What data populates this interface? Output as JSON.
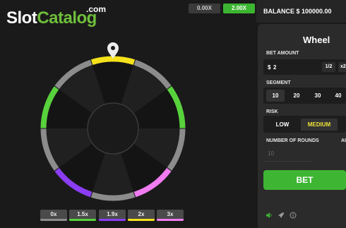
{
  "logo": {
    "word1": "Slot",
    "word2": "Catalog",
    "suffix": ".com"
  },
  "history": [
    "0.00X",
    "2.00X"
  ],
  "balance": "BALANCE $ 100000.00",
  "panel": {
    "title": "Wheel",
    "bet_amount_label": "BET AMOUNT",
    "currency": "$",
    "bet_amount": "2",
    "half_label": "1/2",
    "double_label": "x2",
    "segment_label": "SEGMENT",
    "segments": [
      "10",
      "20",
      "30",
      "40"
    ],
    "selected_segment": "10",
    "risk_label": "RISK",
    "risk_options": [
      "LOW",
      "MEDIUM"
    ],
    "selected_risk": "MEDIUM",
    "rounds_label": "NUMBER OF ROUNDS",
    "rounds_value": "10",
    "auto_label": "AU",
    "bet_button": "BET"
  },
  "wheel": {
    "segment_count": 10,
    "segments": [
      {
        "multiplier": "2x",
        "color": "#f5e21b"
      },
      {
        "multiplier": "0x",
        "color": "#8c8c8c"
      },
      {
        "multiplier": "1.5x",
        "color": "#58d23c"
      },
      {
        "multiplier": "0x",
        "color": "#8c8c8c"
      },
      {
        "multiplier": "3x",
        "color": "#f07cf0"
      },
      {
        "multiplier": "0x",
        "color": "#8c8c8c"
      },
      {
        "multiplier": "1.9x",
        "color": "#8a3df5"
      },
      {
        "multiplier": "0x",
        "color": "#8c8c8c"
      },
      {
        "multiplier": "1.5x",
        "color": "#58d23c"
      },
      {
        "multiplier": "0x",
        "color": "#8c8c8c"
      }
    ]
  },
  "legend": [
    {
      "label": "0x",
      "color": "#8c8c8c"
    },
    {
      "label": "1.5x",
      "color": "#58d23c"
    },
    {
      "label": "1.9x",
      "color": "#8a3df5"
    },
    {
      "label": "2x",
      "color": "#f5e21b"
    },
    {
      "label": "3x",
      "color": "#f07cf0"
    }
  ],
  "footer_icons": [
    "sound-icon",
    "rocket-icon",
    "info-icon"
  ],
  "colors": {
    "accent": "#3fb534",
    "pointer": "#ececec"
  }
}
